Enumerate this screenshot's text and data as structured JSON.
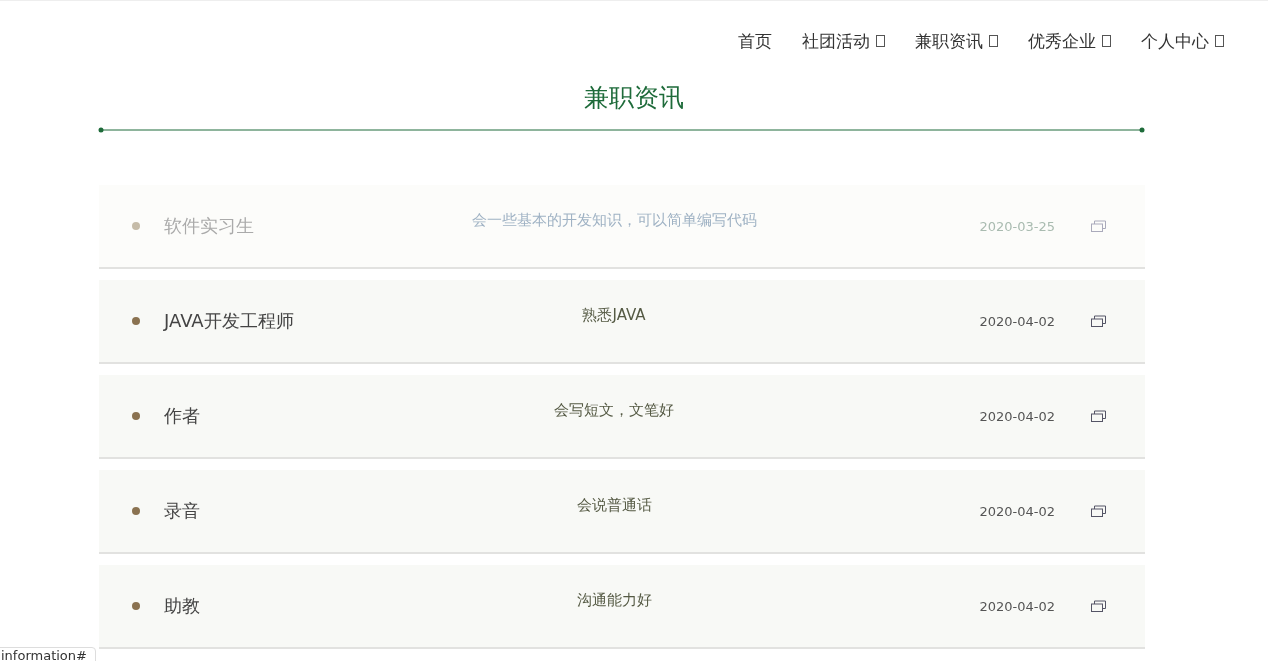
{
  "nav": [
    {
      "label": "首页",
      "dropdown": false
    },
    {
      "label": "社团活动",
      "dropdown": true
    },
    {
      "label": "兼职资讯",
      "dropdown": true
    },
    {
      "label": "优秀企业",
      "dropdown": true
    },
    {
      "label": "个人中心",
      "dropdown": true
    }
  ],
  "section_title": "兼职资讯",
  "jobs": [
    {
      "title": "软件实习生",
      "description": "会一些基本的开发知识，可以简单编写代码",
      "date": "2020-03-25",
      "faded": true
    },
    {
      "title": "JAVA开发工程师",
      "description": "熟悉JAVA",
      "date": "2020-04-02",
      "faded": false
    },
    {
      "title": "作者",
      "description": "会写短文，文笔好",
      "date": "2020-04-02",
      "faded": false
    },
    {
      "title": "录音",
      "description": "会说普通话",
      "date": "2020-04-02",
      "faded": false
    },
    {
      "title": "助教",
      "description": "沟通能力好",
      "date": "2020-04-02",
      "faded": false
    }
  ],
  "status_bar": "information#"
}
